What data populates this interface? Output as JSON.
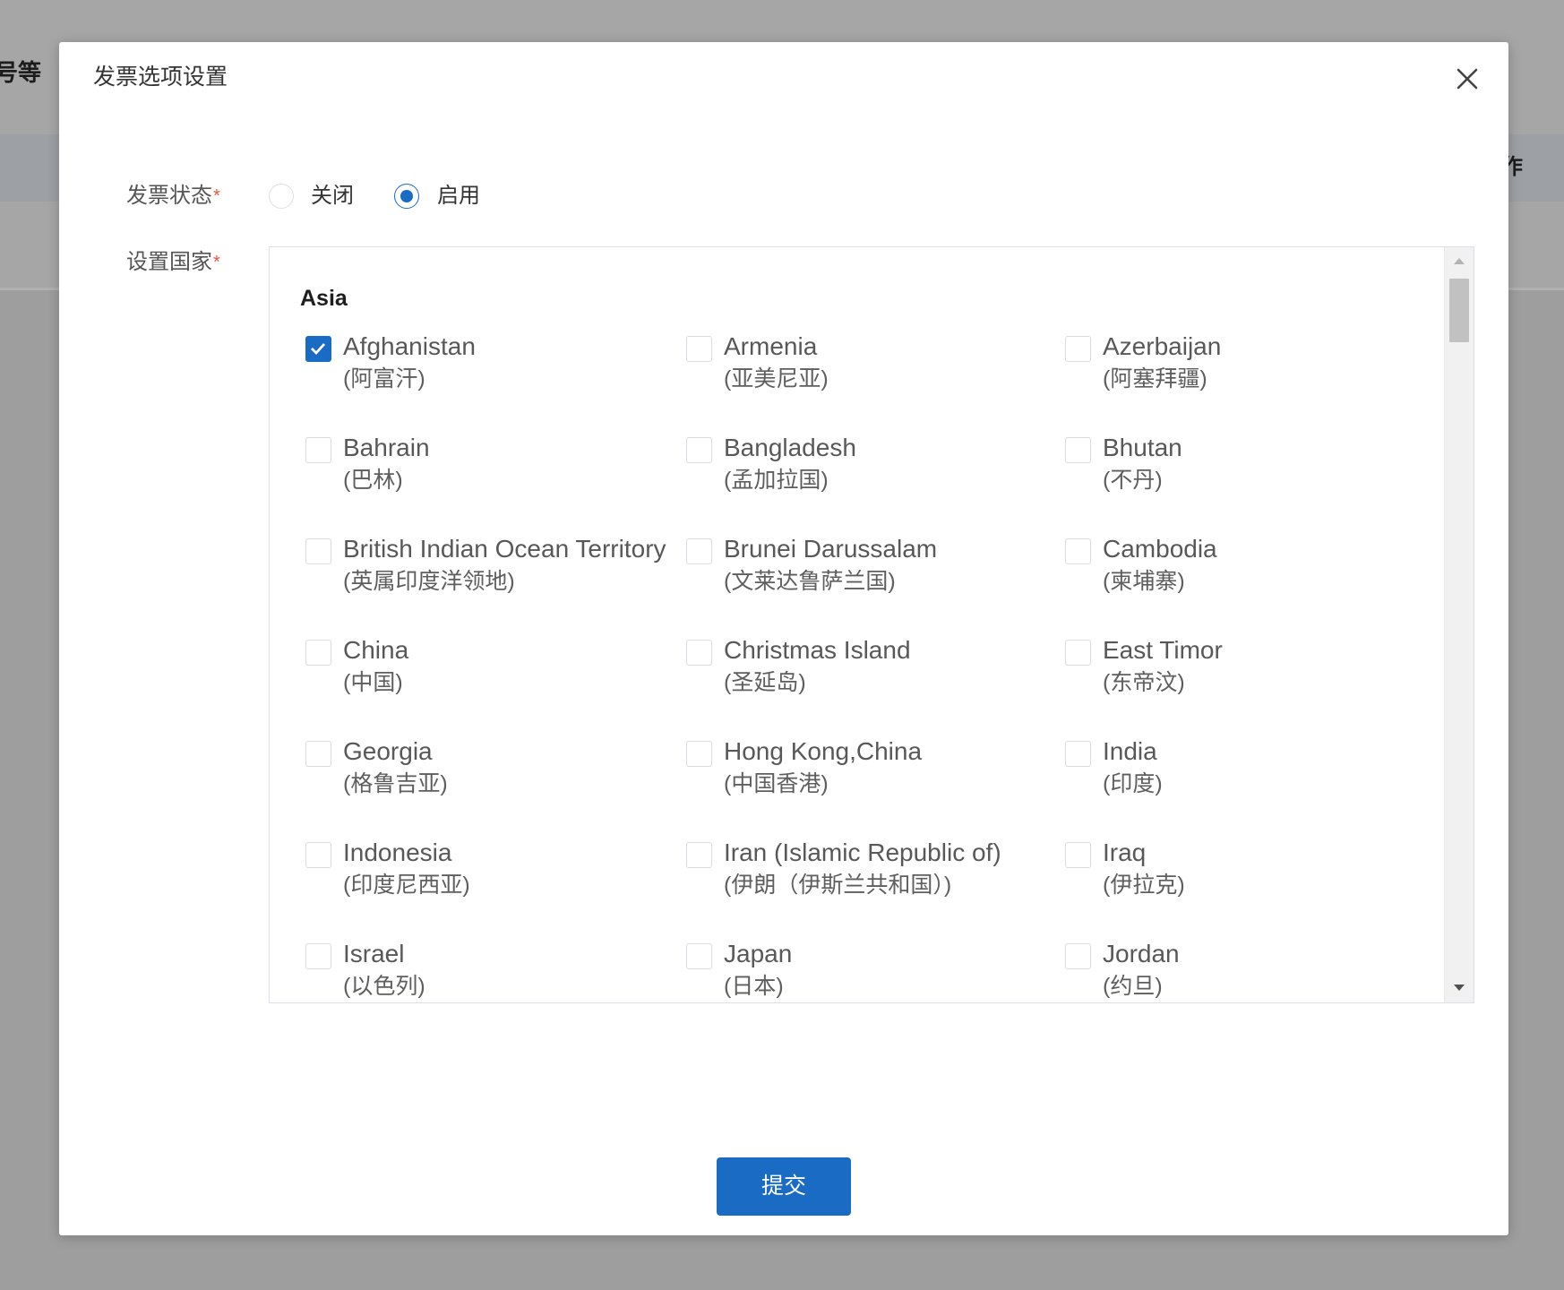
{
  "background": {
    "text_left": "号等",
    "text_right": "作"
  },
  "modal": {
    "title": "发票选项设置"
  },
  "form": {
    "status": {
      "label": "发票状态",
      "required_mark": "*",
      "options": [
        {
          "label": "关闭",
          "selected": false
        },
        {
          "label": "启用",
          "selected": true
        }
      ]
    },
    "countries": {
      "label": "设置国家",
      "required_mark": "*",
      "groups": [
        {
          "region": "Asia",
          "items": [
            {
              "name": "Afghanistan",
              "name_cn": "(阿富汗)",
              "checked": true
            },
            {
              "name": "Armenia",
              "name_cn": "(亚美尼亚)",
              "checked": false
            },
            {
              "name": "Azerbaijan",
              "name_cn": "(阿塞拜疆)",
              "checked": false
            },
            {
              "name": "Bahrain",
              "name_cn": "(巴林)",
              "checked": false
            },
            {
              "name": "Bangladesh",
              "name_cn": "(孟加拉国)",
              "checked": false
            },
            {
              "name": "Bhutan",
              "name_cn": "(不丹)",
              "checked": false
            },
            {
              "name": "British Indian Ocean Territory",
              "name_cn": "(英属印度洋领地)",
              "checked": false
            },
            {
              "name": "Brunei Darussalam",
              "name_cn": "(文莱达鲁萨兰国)",
              "checked": false
            },
            {
              "name": "Cambodia",
              "name_cn": "(柬埔寨)",
              "checked": false
            },
            {
              "name": "China",
              "name_cn": "(中国)",
              "checked": false
            },
            {
              "name": "Christmas Island",
              "name_cn": "(圣延岛)",
              "checked": false
            },
            {
              "name": "East Timor",
              "name_cn": "(东帝汶)",
              "checked": false
            },
            {
              "name": "Georgia",
              "name_cn": "(格鲁吉亚)",
              "checked": false
            },
            {
              "name": "Hong Kong,China",
              "name_cn": "(中国香港)",
              "checked": false
            },
            {
              "name": "India",
              "name_cn": "(印度)",
              "checked": false
            },
            {
              "name": "Indonesia",
              "name_cn": "(印度尼西亚)",
              "checked": false
            },
            {
              "name": "Iran (Islamic Republic of)",
              "name_cn": "(伊朗（伊斯兰共和国）)",
              "checked": false
            },
            {
              "name": "Iraq",
              "name_cn": "(伊拉克)",
              "checked": false
            },
            {
              "name": "Israel",
              "name_cn": "(以色列)",
              "checked": false
            },
            {
              "name": "Japan",
              "name_cn": "(日本)",
              "checked": false
            },
            {
              "name": "Jordan",
              "name_cn": "(约旦)",
              "checked": false
            }
          ]
        }
      ]
    }
  },
  "submit_label": "提交",
  "icons": {
    "close": "close-icon",
    "check": "check-icon",
    "scroll_up": "triangle-up-icon",
    "scroll_down": "triangle-down-icon"
  },
  "colors": {
    "primary": "#1a6bc4",
    "required": "#e8533f"
  }
}
